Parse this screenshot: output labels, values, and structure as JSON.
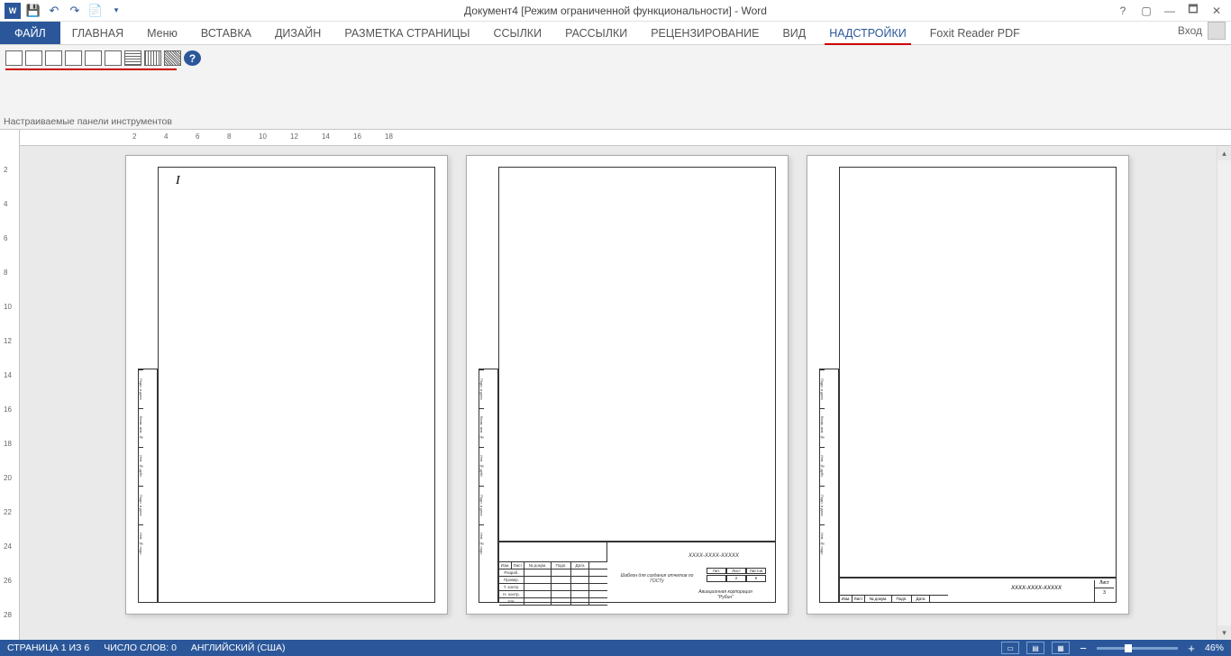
{
  "title": "Документ4 [Режим ограниченной функциональности] - Word",
  "qat": {
    "save": "💾",
    "undo": "↶",
    "redo": "↷",
    "new": "📄",
    "dd": "▾"
  },
  "wincontrols": {
    "help": "?",
    "ribbon": "▢",
    "min": "—",
    "max": "🗖",
    "close": "✕"
  },
  "tabs": {
    "file": "ФАЙЛ",
    "home": "ГЛАВНАЯ",
    "menu": "Меню",
    "insert": "ВСТАВКА",
    "design": "ДИЗАЙН",
    "layout": "РАЗМЕТКА СТРАНИЦЫ",
    "refs": "ССЫЛКИ",
    "mail": "РАССЫЛКИ",
    "review": "РЕЦЕНЗИРОВАНИЕ",
    "view": "ВИД",
    "addins": "НАДСТРОЙКИ",
    "foxit": "Foxit Reader PDF"
  },
  "signin": "Вход",
  "group_label": "Настраиваемые панели инструментов",
  "ruler_h": [
    "2",
    "4",
    "6",
    "8",
    "10",
    "12",
    "14",
    "16",
    "18"
  ],
  "ruler_v": [
    "",
    "2",
    "4",
    "6",
    "8",
    "10",
    "12",
    "14",
    "16",
    "18",
    "20",
    "22",
    "24",
    "26",
    "28"
  ],
  "page1": {
    "cursor": "I"
  },
  "stamp": {
    "code": "XXXX-XXXX-XXXXX",
    "desc": "Шаблон для создания отчетов по ГОСТу",
    "org": "Авиационная корпорация \"Рубин\"",
    "lit": "Лит.",
    "list": "Лист",
    "listov": "Листов",
    "listval": "2",
    "listovval": "6",
    "list3": "3",
    "side": [
      "Подп. и дата",
      "Взам. инв. №",
      "Инв. № дубл.",
      "Подп. и дата",
      "Инв. № подл."
    ],
    "rows": [
      "Изм.",
      "Лист",
      "№ докум.",
      "Подп.",
      "Дата",
      "Разраб.",
      "Провер.",
      "Т. контр.",
      "Н. контр.",
      "Утв."
    ]
  },
  "status": {
    "page": "СТРАНИЦА 1 ИЗ 6",
    "words": "ЧИСЛО СЛОВ: 0",
    "lang": "АНГЛИЙСКИЙ (США)",
    "zoom": "46%"
  }
}
